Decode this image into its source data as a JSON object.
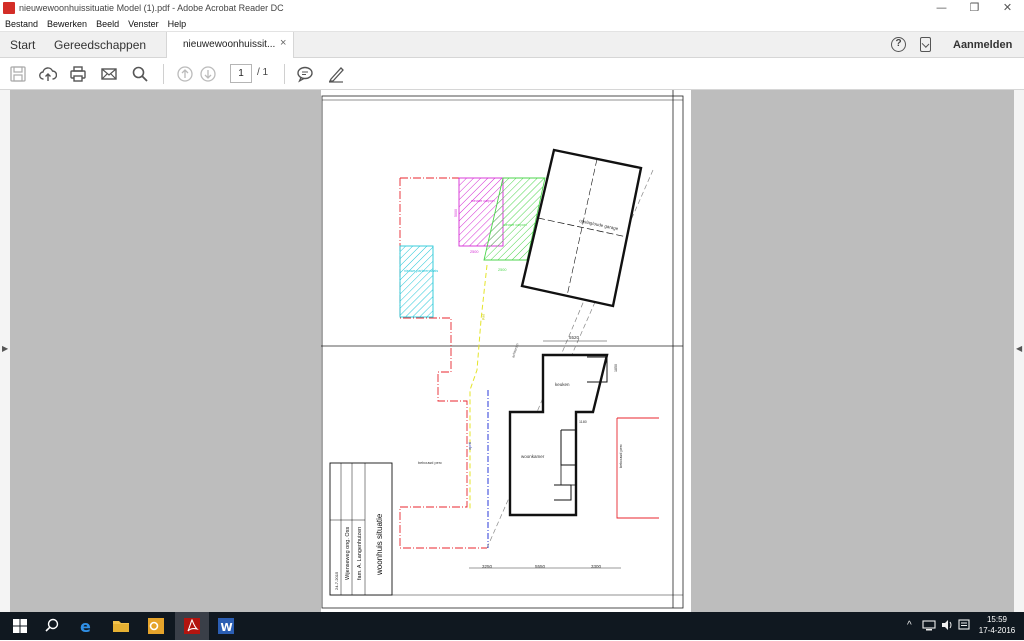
{
  "window": {
    "title": "nieuwewoonhuissituatie Model (1).pdf - Adobe Acrobat Reader DC",
    "controls": {
      "minimize": "—",
      "restore": "❐",
      "close": "✕"
    }
  },
  "menu": [
    "Bestand",
    "Bewerken",
    "Beeld",
    "Venster",
    "Help"
  ],
  "tabs": {
    "start": "Start",
    "tools": "Gereedschappen",
    "document": "nieuwewoonhuissit...",
    "close": "×"
  },
  "header_right": {
    "help": "?",
    "signin": "Aanmelden"
  },
  "toolbar": {
    "icons": [
      "save-icon",
      "upload-icon",
      "print-icon",
      "email-icon",
      "search-icon",
      "page-up-icon",
      "page-down-icon",
      "comment-icon",
      "sign-icon"
    ],
    "page_current": "1",
    "page_total": "/ 1"
  },
  "drawing": {
    "labels": {
      "garage": "opslag/oude garage",
      "kitchen": "keuken",
      "living": "woonkamer",
      "neighbor_left": "bebouwd perc",
      "neighbor_right": "bebouwd perc",
      "title": "woonhuis situatie",
      "owner": "fam. A. Langenhuizen",
      "address": "Wijenseweg ong. Oss",
      "dim_top": "5520",
      "dim_bottom_1": "3250",
      "dim_bottom_2": "5550",
      "dim_bottom_3": "3300",
      "dim_small_1": "2500",
      "dim_small_2": "2500",
      "dim_side_1": "5000",
      "dim_side_2": "1850",
      "dim_side_3": "1180",
      "green_label": "nieuwe carport",
      "magenta_label": "nieuwe carport",
      "cyan_label": "nieuwe parkeerplaats",
      "blue_label": "oprit",
      "path_label": "pad",
      "drive_label": "achterom",
      "date": "24-7-2015"
    },
    "colors": {
      "boundary_red": "#e8262d",
      "magenta": "#d42bd4",
      "green": "#4cd64c",
      "cyan": "#25c7d8",
      "yellow": "#e4e42a",
      "blue": "#2a3ad8"
    }
  },
  "taskbar": {
    "icons": [
      "windows-start-icon",
      "search-icon",
      "edge-icon",
      "explorer-icon",
      "outlook-icon",
      "acrobat-icon",
      "word-icon"
    ],
    "tray_icons": [
      "chevron-up-icon",
      "network-icon",
      "volume-icon",
      "notification-icon"
    ],
    "time": "15:59",
    "date": "17-4-2016"
  }
}
